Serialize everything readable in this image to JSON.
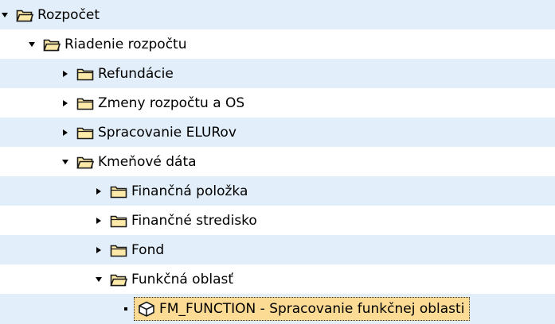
{
  "tree": {
    "items": [
      {
        "label": "Rozpočet",
        "state": "expanded",
        "icon": "folder-open-icon"
      },
      {
        "label": "Riadenie rozpočtu",
        "state": "expanded",
        "icon": "folder-open-icon"
      },
      {
        "label": "Refundácie",
        "state": "collapsed",
        "icon": "folder-closed-icon"
      },
      {
        "label": "Zmeny rozpočtu a OS",
        "state": "collapsed",
        "icon": "folder-closed-icon"
      },
      {
        "label": "Spracovanie ELURov",
        "state": "collapsed",
        "icon": "folder-closed-icon"
      },
      {
        "label": "Kmeňové dáta",
        "state": "expanded",
        "icon": "folder-open-icon"
      },
      {
        "label": "Finančná položka",
        "state": "collapsed",
        "icon": "folder-closed-icon"
      },
      {
        "label": "Finančné stredisko",
        "state": "collapsed",
        "icon": "folder-closed-icon"
      },
      {
        "label": "Fond",
        "state": "collapsed",
        "icon": "folder-closed-icon"
      },
      {
        "label": "Funkčná oblasť",
        "state": "expanded",
        "icon": "folder-open-icon"
      },
      {
        "label": "FM_FUNCTION - Spracovanie funkčnej oblasti",
        "state": "leaf",
        "icon": "transaction-cube-icon",
        "selected": true
      }
    ]
  },
  "colors": {
    "row_alt": "#e2eef9",
    "selection": "#fcdb94",
    "folder_fill": "#fde9a8",
    "folder_stroke": "#1a1a1a"
  }
}
